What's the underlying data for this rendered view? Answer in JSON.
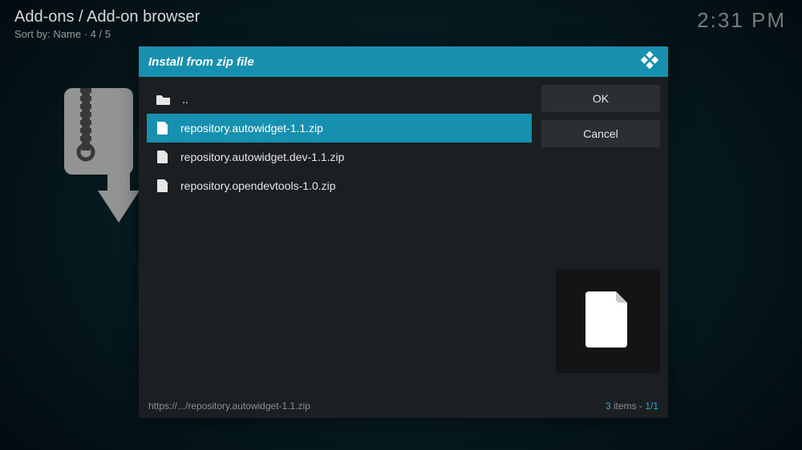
{
  "header": {
    "breadcrumb": "Add-ons / Add-on browser",
    "sort_prefix": "Sort by: ",
    "sort_value": "Name",
    "sort_sep": "  ·  ",
    "index": "4 / 5",
    "clock": "2:31 PM"
  },
  "dialog": {
    "title": "Install from zip file",
    "parent_label": "..",
    "files": [
      {
        "name": "repository.autowidget-1.1.zip",
        "selected": true
      },
      {
        "name": "repository.autowidget.dev-1.1.zip",
        "selected": false
      },
      {
        "name": "repository.opendevtools-1.0.zip",
        "selected": false
      }
    ],
    "buttons": {
      "ok": "OK",
      "cancel": "Cancel"
    },
    "footer_path": "https://.../repository.autowidget-1.1.zip",
    "footer_count_num": "3",
    "footer_count_word": " items - ",
    "footer_page": "1/1"
  }
}
